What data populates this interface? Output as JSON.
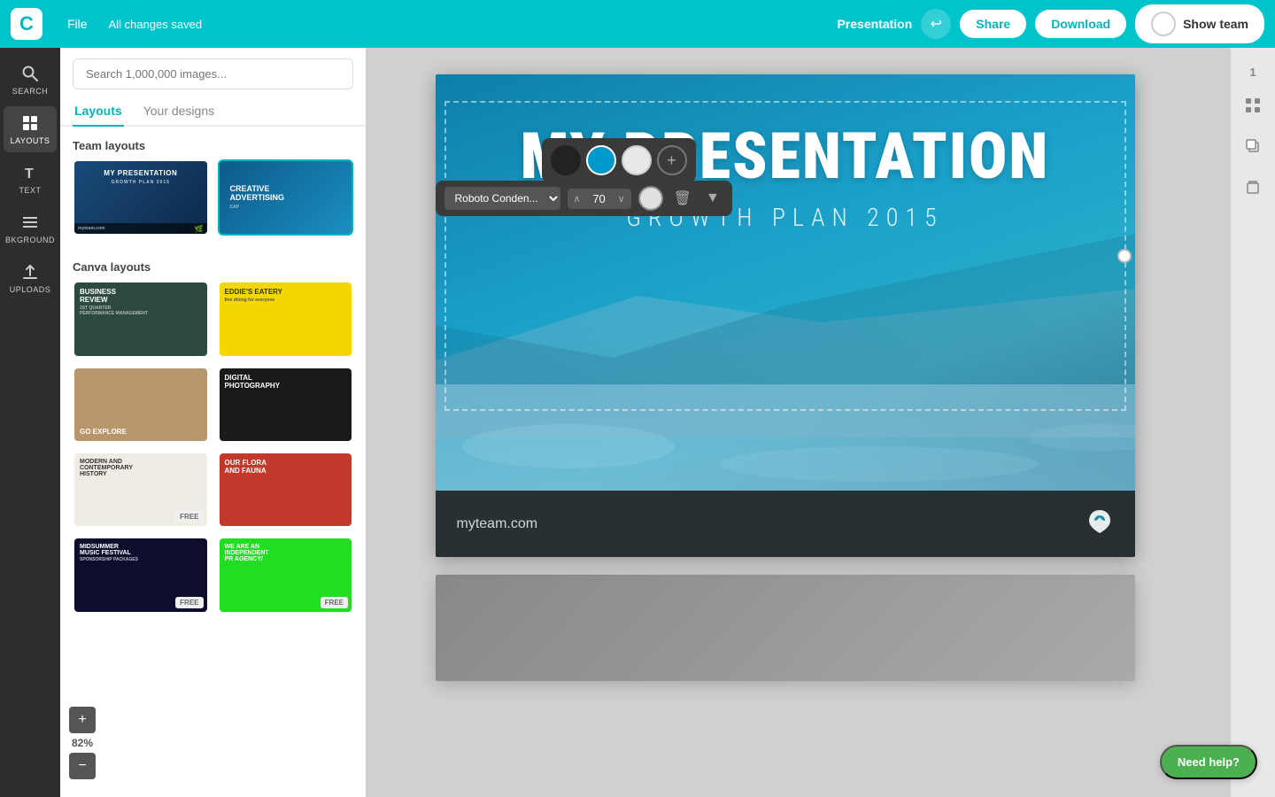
{
  "topbar": {
    "logo_text": "C",
    "file_label": "File",
    "saved_label": "All changes saved",
    "presentation_label": "Presentation",
    "share_label": "Share",
    "download_label": "Download",
    "show_team_label": "Show team",
    "undo_icon": "↩"
  },
  "sidebar": {
    "items": [
      {
        "id": "search",
        "label": "SEARCH",
        "icon": "🔍"
      },
      {
        "id": "layouts",
        "label": "LAYOUTS",
        "icon": "⊞",
        "active": true
      },
      {
        "id": "text",
        "label": "TEXT",
        "icon": "T"
      },
      {
        "id": "background",
        "label": "BKGROUND",
        "icon": "≡"
      },
      {
        "id": "uploads",
        "label": "UPLOADS",
        "icon": "↑"
      }
    ]
  },
  "left_panel": {
    "search_placeholder": "Search 1,000,000 images...",
    "tabs": [
      {
        "id": "layouts",
        "label": "Layouts",
        "active": true
      },
      {
        "id": "your_designs",
        "label": "Your designs",
        "active": false
      }
    ],
    "team_layouts_title": "Team layouts",
    "team_layouts": [
      {
        "id": "my-presentation",
        "label": "MY PRESENTATION",
        "subtitle": "GROWTH PLAN 2015",
        "style": "my-presentation"
      },
      {
        "id": "creative-advertising",
        "label": "CREATIVE ADVERTISING",
        "style": "creative"
      }
    ],
    "canva_layouts_title": "Canva layouts",
    "canva_layouts": [
      {
        "id": "business-review",
        "label": "BUSINESS REVIEW",
        "style": "business",
        "free": false
      },
      {
        "id": "eddies-eatery",
        "label": "EDDIE'S EATERY",
        "style": "eddies",
        "free": false
      },
      {
        "id": "go-explore",
        "label": "GO EXPLORE",
        "style": "go-explore",
        "free": false
      },
      {
        "id": "digital-photography",
        "label": "DIGITAL PHOTOGRAPHY",
        "style": "digital-photo",
        "free": false
      },
      {
        "id": "modern-contemporary",
        "label": "MODERN AND CONTEMPORARY HISTORY",
        "style": "modern",
        "free": true
      },
      {
        "id": "flora-fauna",
        "label": "OUR FLORA AND FAUNA",
        "style": "flora",
        "free": false
      },
      {
        "id": "midsummer",
        "label": "MIDSUMMER SPONSORSHIP PACKAGES",
        "style": "midsummer",
        "free": true
      },
      {
        "id": "independent-pr",
        "label": "WE ARE AN INDEPENDENT PR AGENCY/",
        "style": "independent",
        "free": true
      }
    ]
  },
  "color_toolbar": {
    "colors": [
      "#222222",
      "#0099cc",
      "#e8e8e8"
    ],
    "add_label": "+"
  },
  "font_toolbar": {
    "font_name": "Roboto Conden...",
    "font_size": "70",
    "delete_icon": "🗑",
    "dropdown_icon": "▼"
  },
  "slide": {
    "title": "MY PRESENTATION",
    "subtitle": "GROWTH PLAN 2015",
    "website": "myteam.com",
    "logo_icon": "🌿"
  },
  "right_panel": {
    "slide_number": "1"
  },
  "zoom": {
    "value": "82%",
    "plus_label": "+",
    "minus_label": "−"
  },
  "help_button": {
    "label": "Need help?"
  }
}
